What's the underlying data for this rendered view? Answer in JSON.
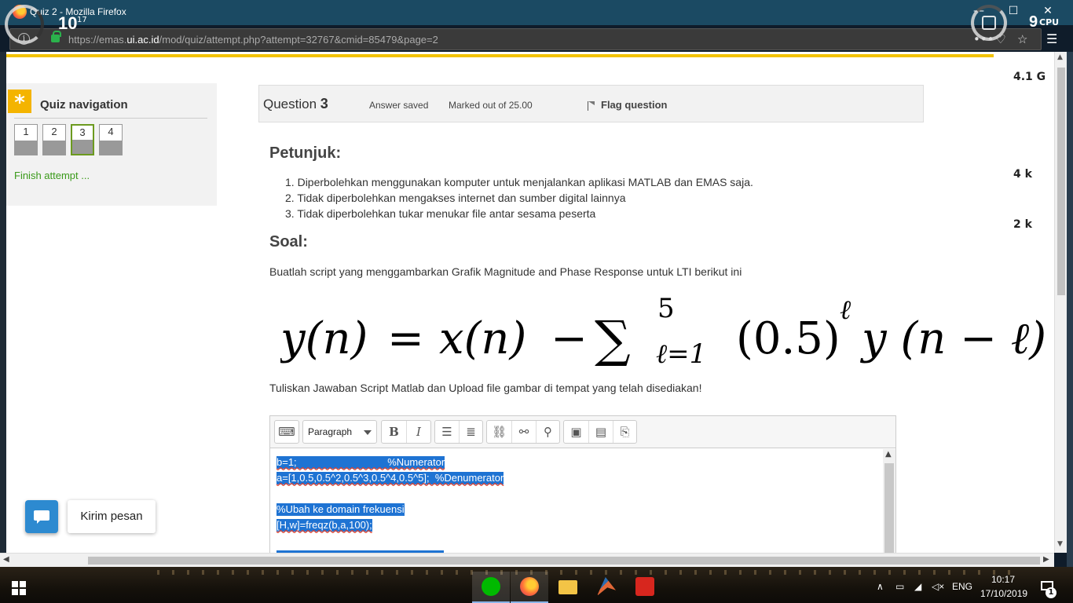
{
  "browser": {
    "window_title": "Quiz 2 - Mozilla Firefox",
    "url_prefix": "https://emas.",
    "url_domain": "ui.ac.id",
    "url_suffix": "/mod/quiz/attempt.php?attempt=32767&cmid=85479&page=2"
  },
  "overlays": {
    "left_gauge_value": "10",
    "left_gauge_sub": "17",
    "right_gauge_value": "9",
    "right_gauge_label": "CPU",
    "side_stats": [
      "4.1 G",
      "4 k",
      "2 k"
    ]
  },
  "quiz_nav": {
    "title": "Quiz navigation",
    "questions": [
      "1",
      "2",
      "3",
      "4"
    ],
    "current_question": "3",
    "finish_link": "Finish attempt ..."
  },
  "question": {
    "label_prefix": "Question",
    "number": "3",
    "status": "Answer saved",
    "marks": "Marked out of 25.00",
    "flag_label": "Flag question",
    "heading_instructions": "Petunjuk:",
    "rules": [
      "Diperbolehkan menggunakan komputer untuk menjalankan aplikasi MATLAB dan EMAS saja.",
      "Tidak diperbolehkan mengakses internet dan sumber digital lainnya",
      "Tidak diperbolehkan tukar menukar file antar sesama peserta"
    ],
    "heading_question": "Soal:",
    "instruction_1": "Buatlah script yang menggambarkan Grafik Magnitude and Phase Response untuk LTI berikut ini",
    "formula": {
      "lhs": "y(n)",
      "equals": "=",
      "term1": "x(n)",
      "minus": "−",
      "sigma": "∑",
      "upper_limit": "5",
      "lower_limit": "ℓ=1",
      "term2": "(0.5)",
      "exponent": "ℓ",
      "term3": "y (n − ℓ)"
    },
    "instruction_2": "Tuliskan Jawaban Script Matlab dan Upload file gambar di tempat yang telah disediakan!"
  },
  "editor": {
    "format_select": "Paragraph",
    "code_lines": [
      "b=1;                                %Numerator",
      "a=[1,0.5,0.5^2,0.5^3,0.5^4,0.5^5];  %Denumerator",
      "%Ubah ke domain frekuensi",
      "[H,w]=freqz(b,a,100);"
    ]
  },
  "chat": {
    "label": "Kirim pesan"
  },
  "taskbar": {
    "language": "ENG",
    "time": "10:17",
    "date": "17/10/2019",
    "notification_count": "1",
    "app_colors": {
      "line": "#00b900",
      "firefox": "#ff7139",
      "explorer": "#f3c446",
      "matlab": "#e16737",
      "acrobat": "#d7261e"
    }
  }
}
